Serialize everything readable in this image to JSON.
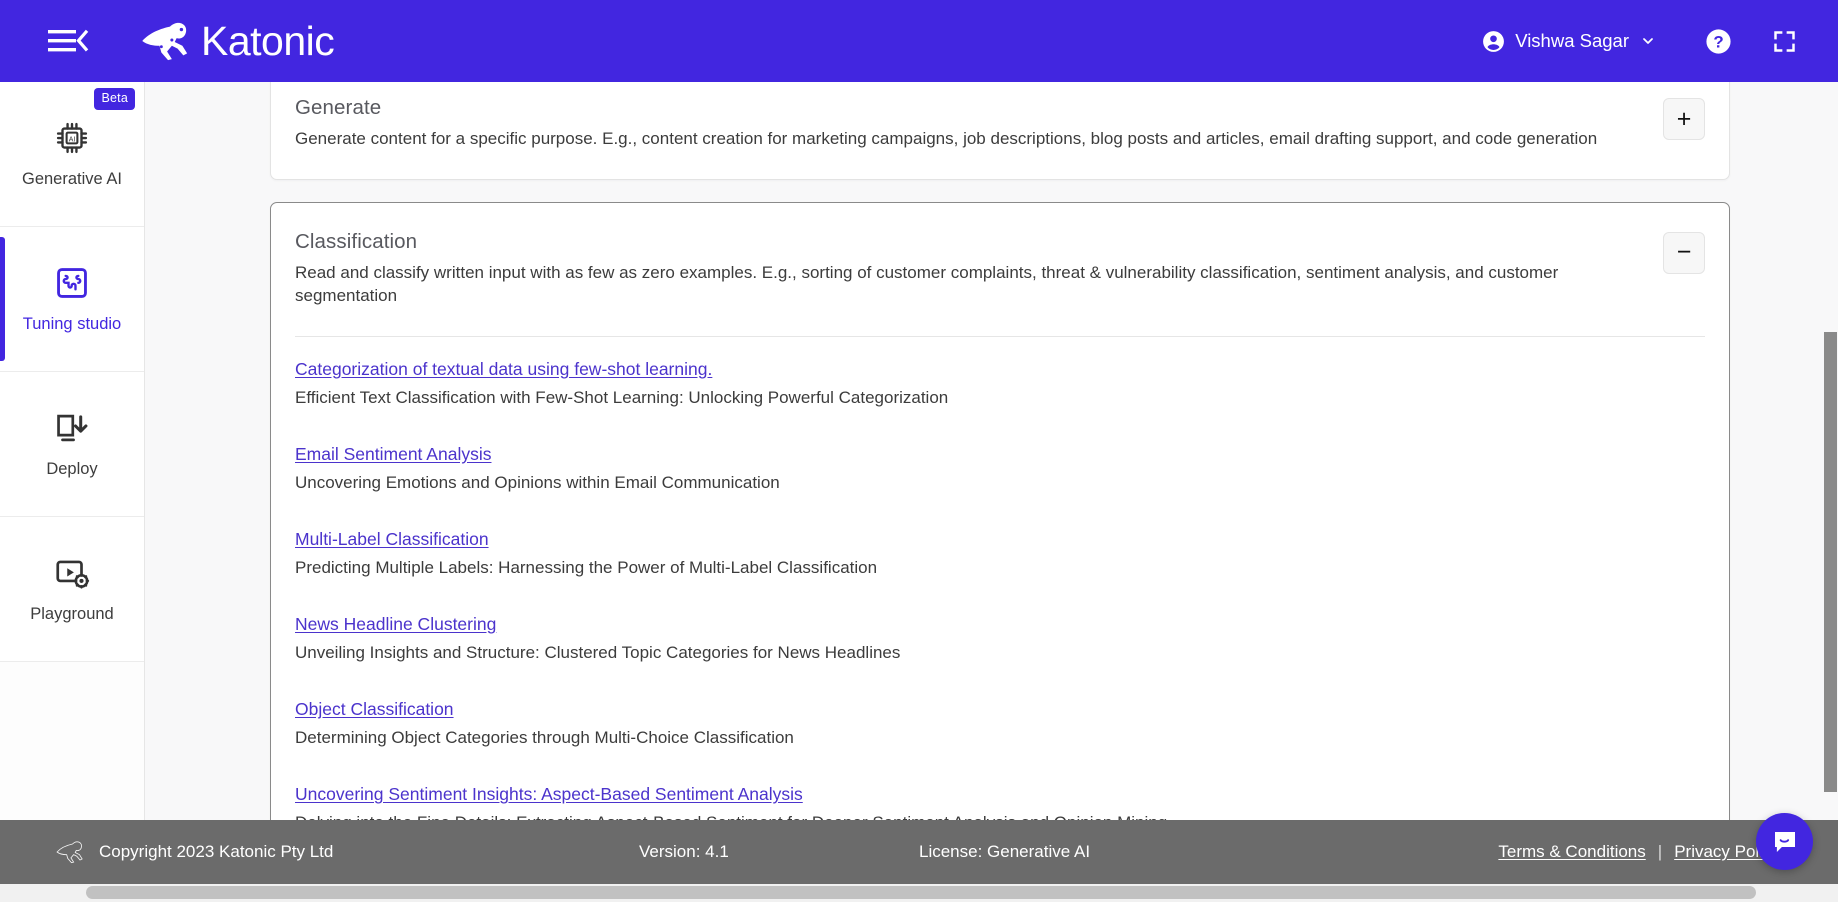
{
  "header": {
    "brand_name": "Katonic",
    "menu_icon": "hamburger-collapse-icon",
    "user_name": "Vishwa Sagar",
    "help_icon": "help-question-icon",
    "fullscreen_icon": "fullscreen-expand-icon"
  },
  "sidebar": {
    "items": [
      {
        "label": "Generative AI",
        "icon": "ai-chip-icon",
        "badge": "Beta",
        "active": false
      },
      {
        "label": "Tuning studio",
        "icon": "puzzle-piece-icon",
        "badge": "",
        "active": true
      },
      {
        "label": "Deploy",
        "icon": "monitor-download-icon",
        "badge": "",
        "active": false
      },
      {
        "label": "Playground",
        "icon": "video-settings-icon",
        "badge": "",
        "active": false
      }
    ]
  },
  "main": {
    "cards": [
      {
        "id": "generate",
        "title": "Generate",
        "description": "Generate content for a specific purpose. E.g., content creation for marketing campaigns, job descriptions, blog posts and articles, email drafting support, and code generation",
        "toggle_label": "+",
        "toggle_icon": "plus-icon",
        "expanded": false,
        "entries": []
      },
      {
        "id": "classification",
        "title": "Classification",
        "description": "Read and classify written input with as few as zero examples. E.g., sorting of customer complaints, threat & vulnerability classification, sentiment analysis, and customer segmentation",
        "toggle_label": "−",
        "toggle_icon": "minus-icon",
        "expanded": true,
        "entries": [
          {
            "link": "Categorization of textual data using few-shot learning.",
            "description": "Efficient Text Classification with Few-Shot Learning: Unlocking Powerful Categorization"
          },
          {
            "link": "Email Sentiment Analysis",
            "description": "Uncovering Emotions and Opinions within Email Communication"
          },
          {
            "link": "Multi-Label Classification",
            "description": "Predicting Multiple Labels: Harnessing the Power of Multi-Label Classification"
          },
          {
            "link": "News Headline Clustering",
            "description": "Unveiling Insights and Structure: Clustered Topic Categories for News Headlines"
          },
          {
            "link": "Object Classification",
            "description": "Determining Object Categories through Multi-Choice Classification"
          },
          {
            "link": "Uncovering Sentiment Insights: Aspect-Based Sentiment Analysis",
            "description": "Delving into the Fine Details: Extracting Aspect-Based Sentiment for Deeper Sentiment Analysis and Opinion Mining"
          }
        ]
      }
    ]
  },
  "footer": {
    "copyright": "Copyright 2023 Katonic Pty Ltd",
    "version": "Version: 4.1",
    "license": "License: Generative AI",
    "terms_label": "Terms & Conditions",
    "separator": "|",
    "privacy_label": "Privacy Policy",
    "logo_icon": "kangaroo-logo-icon"
  },
  "chat": {
    "icon": "chat-bubble-icon"
  },
  "colors": {
    "brand_purple": "#4226E0",
    "link_purple": "#4B33CC",
    "footer_gray": "#6B6B6B",
    "content_bg": "#F8F8F9"
  }
}
